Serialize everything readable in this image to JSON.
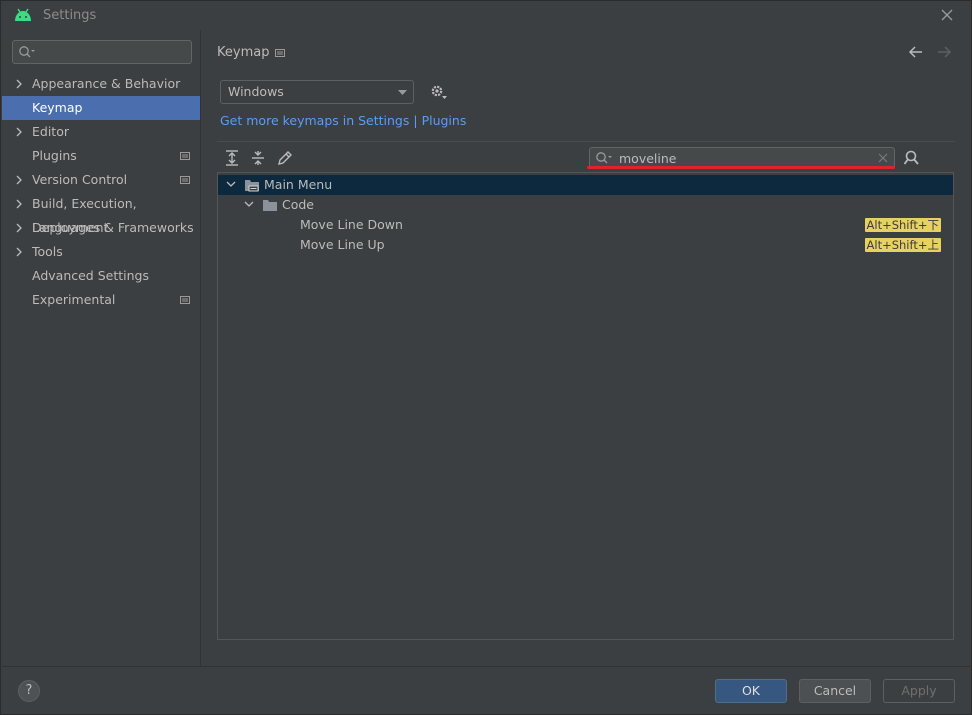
{
  "window": {
    "title": "Settings",
    "app_icon": "android-icon",
    "close_icon": "close-icon"
  },
  "sidebar": {
    "search": {
      "value": "",
      "icon": "search-icon"
    },
    "items": [
      {
        "label": "Appearance & Behavior",
        "expandable": true,
        "badge": false,
        "selected": false
      },
      {
        "label": "Keymap",
        "expandable": false,
        "badge": false,
        "selected": true
      },
      {
        "label": "Editor",
        "expandable": true,
        "badge": false,
        "selected": false
      },
      {
        "label": "Plugins",
        "expandable": false,
        "badge": true,
        "selected": false
      },
      {
        "label": "Version Control",
        "expandable": true,
        "badge": true,
        "selected": false
      },
      {
        "label": "Build, Execution, Deployment",
        "expandable": true,
        "badge": false,
        "selected": false
      },
      {
        "label": "Languages & Frameworks",
        "expandable": true,
        "badge": false,
        "selected": false
      },
      {
        "label": "Tools",
        "expandable": true,
        "badge": false,
        "selected": false
      },
      {
        "label": "Advanced Settings",
        "expandable": false,
        "badge": false,
        "selected": false
      },
      {
        "label": "Experimental",
        "expandable": false,
        "badge": true,
        "selected": false
      }
    ]
  },
  "main": {
    "title": "Keymap",
    "keymap_select": {
      "value": "Windows"
    },
    "links": {
      "settings": "Get more keymaps in Settings",
      "separator": " | ",
      "plugins": "Plugins"
    },
    "toolbar": {
      "icons": [
        "expand-all-icon",
        "collapse-all-icon",
        "edit-icon"
      ],
      "filter": {
        "value": "moveline"
      },
      "find_by_shortcut_icon": "find-by-shortcut-icon"
    },
    "tree": [
      {
        "label": "Main Menu",
        "level": 0,
        "type": "group",
        "icon": "menu-folder-icon",
        "selected": true,
        "shortcut": ""
      },
      {
        "label": "Code",
        "level": 1,
        "type": "group",
        "icon": "folder-icon",
        "selected": false,
        "shortcut": ""
      },
      {
        "label": "Move Line Down",
        "level": 2,
        "type": "action",
        "selected": false,
        "shortcut": "Alt+Shift+下"
      },
      {
        "label": "Move Line Up",
        "level": 2,
        "type": "action",
        "selected": false,
        "shortcut": "Alt+Shift+上"
      }
    ]
  },
  "footer": {
    "help": "?",
    "ok": "OK",
    "cancel": "Cancel",
    "apply": "Apply"
  },
  "colors": {
    "accent": "#4b6eaf",
    "link": "#589df6",
    "highlight": "#e8d163",
    "marker": "#e0232b",
    "background": "#3c3f41"
  }
}
